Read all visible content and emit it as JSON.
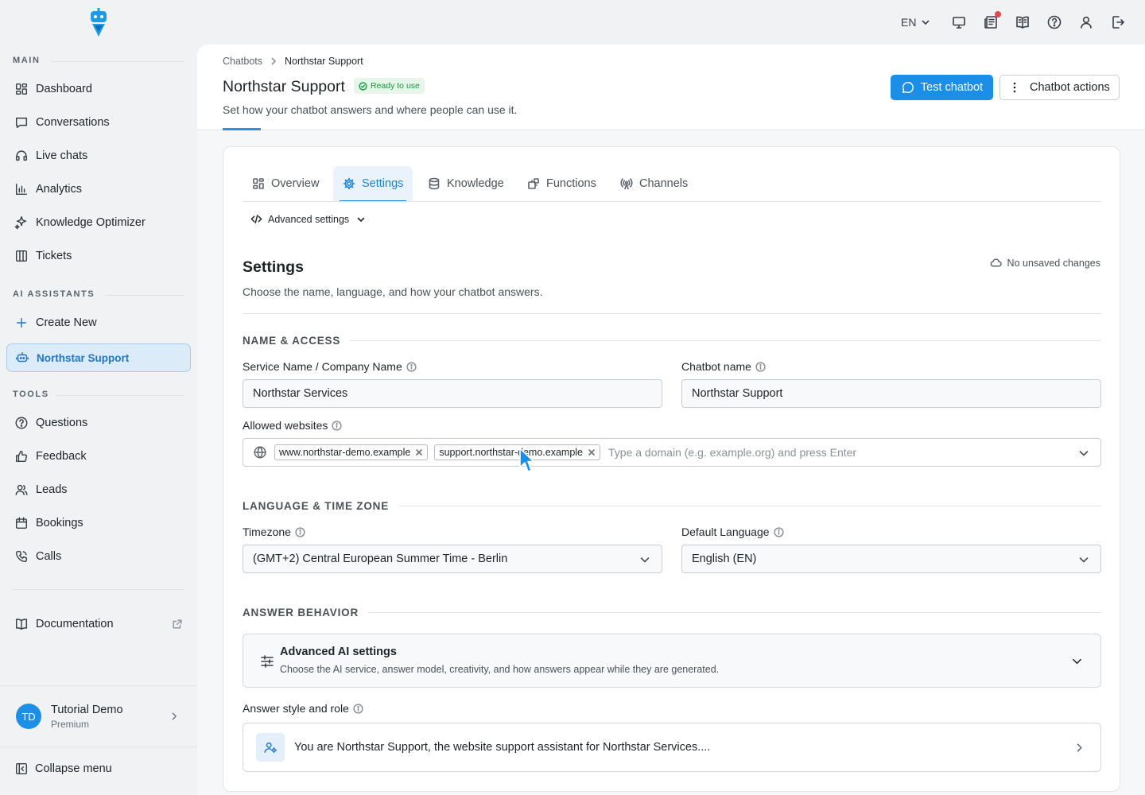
{
  "sidebar": {
    "sections": {
      "main": "MAIN",
      "ai": "AI ASSISTANTS",
      "tools": "TOOLS"
    },
    "main_items": [
      {
        "label": "Dashboard",
        "icon": "dashboard-icon"
      },
      {
        "label": "Conversations",
        "icon": "chat-icon"
      },
      {
        "label": "Live chats",
        "icon": "headset-icon"
      },
      {
        "label": "Analytics",
        "icon": "bar-chart-icon"
      },
      {
        "label": "Knowledge Optimizer",
        "icon": "sparkle-icon"
      },
      {
        "label": "Tickets",
        "icon": "columns-icon"
      }
    ],
    "ai_items": [
      {
        "label": "Create New",
        "icon": "plus-icon"
      },
      {
        "label": "Northstar Support",
        "icon": "bot-icon",
        "active": true
      }
    ],
    "tool_items": [
      {
        "label": "Questions",
        "icon": "question-icon"
      },
      {
        "label": "Feedback",
        "icon": "thumbs-up-icon"
      },
      {
        "label": "Leads",
        "icon": "users-icon"
      },
      {
        "label": "Bookings",
        "icon": "calendar-icon"
      },
      {
        "label": "Calls",
        "icon": "phone-icon"
      }
    ],
    "documentation": "Documentation",
    "user": {
      "initials": "TD",
      "name": "Tutorial Demo",
      "plan": "Premium"
    },
    "collapse": "Collapse menu"
  },
  "topbar": {
    "language": "EN"
  },
  "header": {
    "breadcrumb": [
      "Chatbots",
      "Northstar Support"
    ],
    "title": "Northstar Support",
    "status_badge": "Ready to use",
    "subtitle": "Set how your chatbot answers and where people can use it.",
    "test_button": "Test chatbot",
    "actions_button": "Chatbot actions"
  },
  "tabs": [
    {
      "label": "Overview",
      "icon": "grid-icon"
    },
    {
      "label": "Settings",
      "icon": "gear-icon",
      "active": true
    },
    {
      "label": "Knowledge",
      "icon": "database-icon"
    },
    {
      "label": "Functions",
      "icon": "puzzle-icon"
    },
    {
      "label": "Channels",
      "icon": "broadcast-icon"
    }
  ],
  "advanced_toggle": "Advanced settings",
  "settings": {
    "title": "Settings",
    "subtitle": "Choose the name, language, and how your chatbot answers.",
    "save_status": "No unsaved changes"
  },
  "name_access": {
    "group_title": "NAME & ACCESS",
    "service_label": "Service Name / Company Name",
    "service_value": "Northstar Services",
    "chatbot_label": "Chatbot name",
    "chatbot_value": "Northstar Support",
    "websites_label": "Allowed websites",
    "websites": [
      "www.northstar-demo.example",
      "support.northstar-demo.example"
    ],
    "websites_placeholder": "Type a domain (e.g. example.org) and press Enter"
  },
  "language_time": {
    "group_title": "LANGUAGE & TIME ZONE",
    "timezone_label": "Timezone",
    "timezone_value": "(GMT+2) Central European Summer Time - Berlin",
    "language_label": "Default Language",
    "language_value": "English (EN)"
  },
  "answer_behavior": {
    "group_title": "ANSWER BEHAVIOR",
    "advanced_ai_title": "Advanced AI settings",
    "advanced_ai_desc": "Choose the AI service, answer model, creativity, and how answers appear while they are generated.",
    "style_label": "Answer style and role",
    "style_value": "You are Northstar Support, the website support assistant for Northstar Services...."
  },
  "colors": {
    "accent": "#1b8ee8",
    "active_nav_bg": "#dcebf8",
    "ready_green": "#20963f",
    "notification": "#e5484d"
  }
}
